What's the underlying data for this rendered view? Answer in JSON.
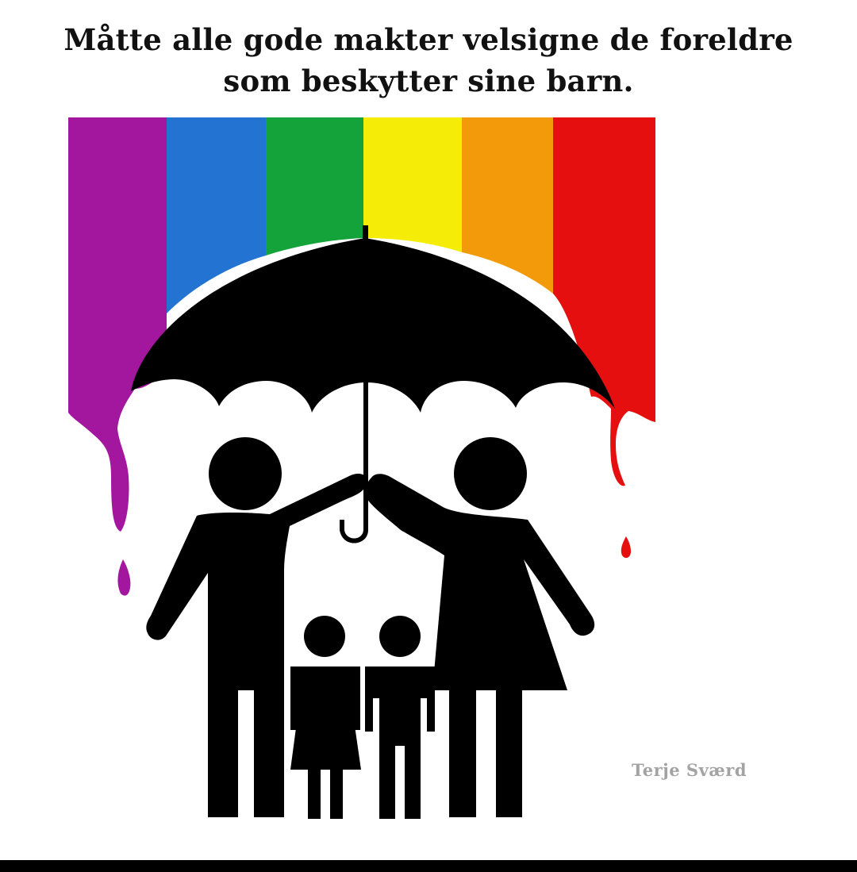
{
  "caption": {
    "line1": "Måtte alle gode makter velsigne de foreldre",
    "line2": "som beskytter sine barn."
  },
  "signature": "Terje Sværd",
  "colors": {
    "purple": "#a3179f",
    "blue": "#2373d2",
    "green": "#14a33a",
    "yellow": "#f5ec08",
    "orange": "#f39a0b",
    "red": "#e60f0f",
    "figure": "#000000",
    "signature": "#a3a3a3"
  },
  "icons": [
    "umbrella-icon",
    "father-figure-icon",
    "mother-figure-icon",
    "girl-figure-icon",
    "boy-figure-icon"
  ]
}
